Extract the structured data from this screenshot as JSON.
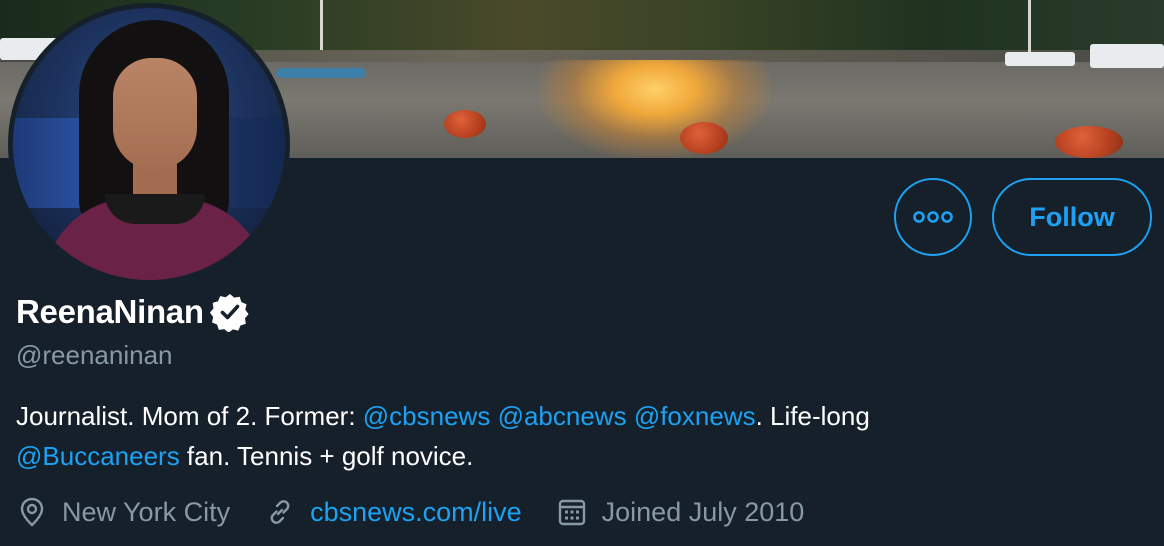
{
  "profile": {
    "display_name": "ReenaNinan",
    "verified_icon": "verified-badge-icon",
    "handle": "@reenaninan",
    "bio": {
      "t1": "Journalist. Mom of 2. Former: ",
      "m1": "@cbsnews",
      "sp1": " ",
      "m2": "@abcnews",
      "sp2": " ",
      "m3": "@foxnews",
      "t2": ". Life-long ",
      "m4": "@Buccaneers",
      "t3": " fan. Tennis + golf novice."
    },
    "location": "New York City",
    "website": "cbsnews.com/live",
    "joined": "Joined July 2010"
  },
  "actions": {
    "more_icon": "more-options-icon",
    "follow_label": "Follow"
  },
  "colors": {
    "background": "#15202b",
    "accent": "#1da1f2",
    "secondary_text": "#8899a6",
    "primary_text": "#ffffff"
  },
  "icons": {
    "location": "location-pin-icon",
    "link": "link-icon",
    "calendar": "calendar-icon"
  }
}
